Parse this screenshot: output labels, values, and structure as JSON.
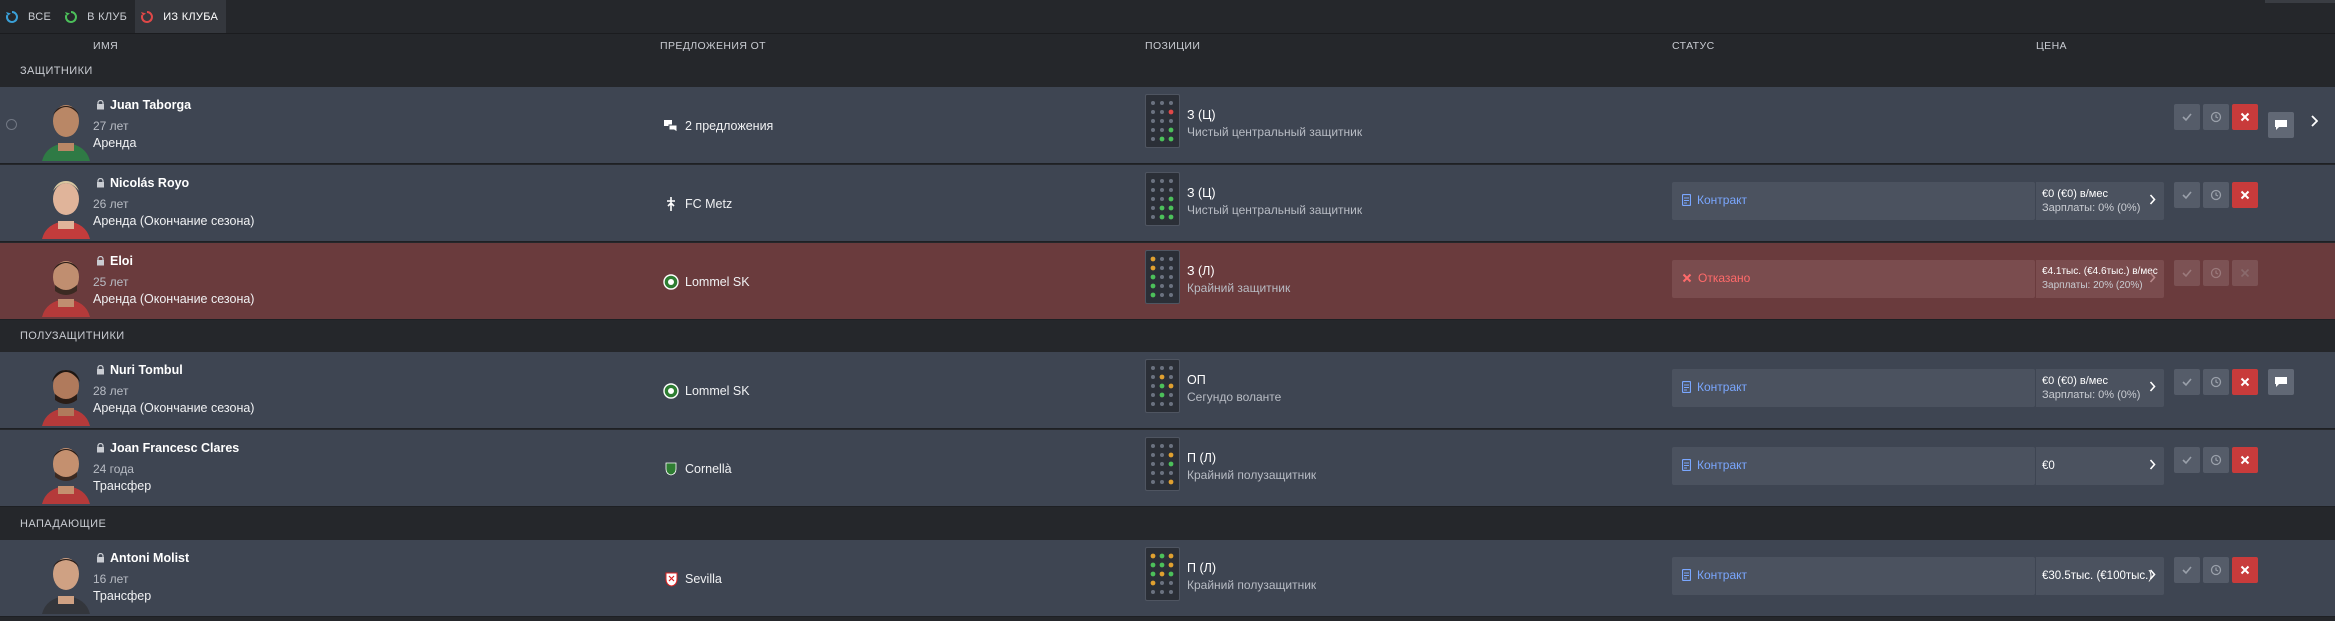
{
  "tabs": [
    {
      "label": "ВСЕ",
      "icon": "cycle-icon",
      "color": "#3aa0d8"
    },
    {
      "label": "В КЛУБ",
      "icon": "cycle-in-icon",
      "color": "#4cc05a"
    },
    {
      "label": "ИЗ КЛУБА",
      "icon": "cycle-out-icon",
      "color": "#e04848",
      "active": true
    }
  ],
  "columns": {
    "name": "ИМЯ",
    "offers": "ПРЕДЛОЖЕНИЯ ОТ",
    "positions": "ПОЗИЦИИ",
    "status": "СТАТУС",
    "price": "ЦЕНА"
  },
  "sections": {
    "defenders": "ЗАЩИТНИКИ",
    "midfielders": "ПОЛУЗАЩИТНИКИ",
    "forwards": "НАПАДАЮЩИЕ"
  },
  "players": [
    {
      "name": "Juan Taborga",
      "age": "27 лет",
      "deal": "Аренда",
      "offer": "2 предложения",
      "offer_icon": "offers-stack-icon",
      "pos_short": "З (Ц)",
      "pos_role": "Чистый центральный защитник",
      "status": "",
      "price1": "",
      "price2": ""
    },
    {
      "name": "Nicolás Royo",
      "age": "26 лет",
      "deal": "Аренда (Окончание сезона)",
      "offer": "FC Metz",
      "offer_icon": "fc-metz-crest-icon",
      "pos_short": "З (Ц)",
      "pos_role": "Чистый центральный защитник",
      "status": "Контракт",
      "price1": "€0 (€0) в/мес",
      "price2": "Зарплаты: 0% (0%)"
    },
    {
      "name": "Eloi",
      "age": "25 лет",
      "deal": "Аренда (Окончание сезона)",
      "offer": "Lommel SK",
      "offer_icon": "lommel-crest-icon",
      "pos_short": "З (Л)",
      "pos_role": "Крайний защитник",
      "status": "Отказано",
      "price1": "€4.1тыс. (€4.6тыс.) в/мес",
      "price2": "Зарплаты: 20% (20%)"
    },
    {
      "name": "Nuri Tombul",
      "age": "28 лет",
      "deal": "Аренда (Окончание сезона)",
      "offer": "Lommel SK",
      "offer_icon": "lommel-crest-icon",
      "pos_short": "ОП",
      "pos_role": "Сегундо воланте",
      "status": "Контракт",
      "price1": "€0 (€0) в/мес",
      "price2": "Зарплаты: 0% (0%)"
    },
    {
      "name": "Joan Francesc Clares",
      "age": "24 года",
      "deal": "Трансфер",
      "offer": "Cornellà",
      "offer_icon": "cornella-crest-icon",
      "pos_short": "П (Л)",
      "pos_role": "Крайний полузащитник",
      "status": "Контракт",
      "price1": "€0",
      "price2": ""
    },
    {
      "name": "Antoni Molist",
      "age": "16 лет",
      "deal": "Трансфер",
      "offer": "Sevilla",
      "offer_icon": "sevilla-crest-icon",
      "pos_short": "П (Л)",
      "pos_role": "Крайний полузащитник",
      "status": "Контракт",
      "price1": "€30.5тыс. (€100тыс.)",
      "price2": ""
    }
  ],
  "colors": {
    "background": "#25272b",
    "row": "#3e4552",
    "row_rejected": "#6a3b3d",
    "contract_text": "#7aa7ff",
    "rejected_text": "#ff6a6a",
    "reject_button": "#c83b3b"
  }
}
